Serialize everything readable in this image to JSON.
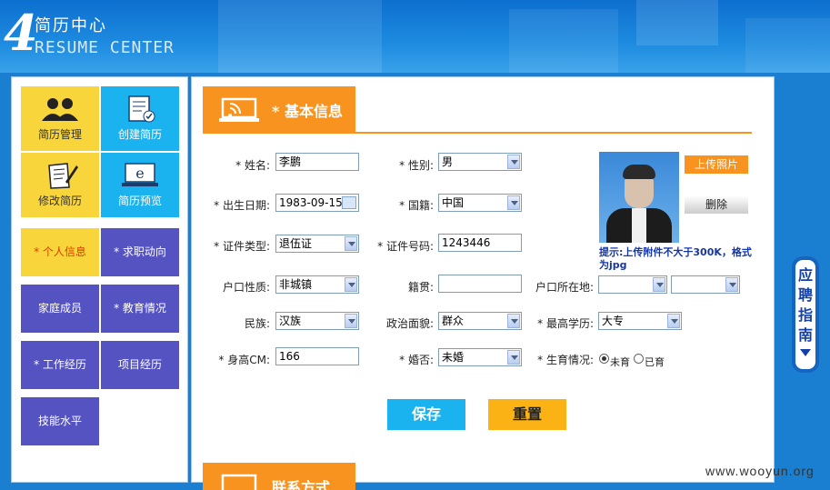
{
  "header": {
    "number": "4",
    "title_cn": "简历中心",
    "title_en": "RESUME CENTER"
  },
  "sidebar": {
    "tiles": [
      {
        "label": "简历管理",
        "icon": "people-icon"
      },
      {
        "label": "创建简历",
        "icon": "document-check-icon"
      },
      {
        "label": "修改简历",
        "icon": "edit-document-icon"
      },
      {
        "label": "简历预览",
        "icon": "browser-preview-icon"
      }
    ],
    "nav": [
      {
        "label": "* 个人信息"
      },
      {
        "label": "* 求职动向"
      },
      {
        "label": "家庭成员"
      },
      {
        "label": "* 教育情况"
      },
      {
        "label": "* 工作经历"
      },
      {
        "label": "项目经历"
      },
      {
        "label": "技能水平"
      }
    ]
  },
  "section": {
    "title": "* 基本信息",
    "next_title": "联系方式"
  },
  "form": {
    "name": {
      "label": "* 姓名:",
      "value": "李鹏"
    },
    "gender": {
      "label": "* 性别:",
      "value": "男"
    },
    "birth": {
      "label": "* 出生日期:",
      "value": "1983-09-15"
    },
    "nationality": {
      "label": "* 国籍:",
      "value": "中国"
    },
    "id_type": {
      "label": "* 证件类型:",
      "value": "退伍证"
    },
    "id_number": {
      "label": "* 证件号码:",
      "value": "1243446"
    },
    "hukou_type": {
      "label": "户口性质:",
      "value": "非城镇"
    },
    "native_place": {
      "label": "籍贯:",
      "value": ""
    },
    "hukou_location": {
      "label": "户口所在地:",
      "value1": "",
      "value2": ""
    },
    "ethnicity": {
      "label": "民族:",
      "value": "汉族"
    },
    "political": {
      "label": "政治面貌:",
      "value": "群众"
    },
    "education": {
      "label": "* 最高学历:",
      "value": "大专"
    },
    "height": {
      "label": "* 身高CM:",
      "value": "166"
    },
    "marriage": {
      "label": "* 婚否:",
      "value": "未婚"
    },
    "fertility": {
      "label": "* 生育情况:",
      "option1": "未育",
      "option2": "已育",
      "selected": "未育"
    }
  },
  "photo": {
    "upload_label": "上传照片",
    "delete_label": "删除",
    "hint": "提示:上传附件不大于300K，格式为jpg"
  },
  "buttons": {
    "save": "保存",
    "reset": "重置"
  },
  "guide": {
    "chars": [
      "应",
      "聘",
      "指",
      "南"
    ]
  },
  "watermark": "www.wooyun.org",
  "colors": {
    "orange": "#f7931e",
    "cyan": "#1ab3f0",
    "yellow": "#f8d53a",
    "purple": "#5552c2",
    "blue": "#1a7fd0"
  }
}
